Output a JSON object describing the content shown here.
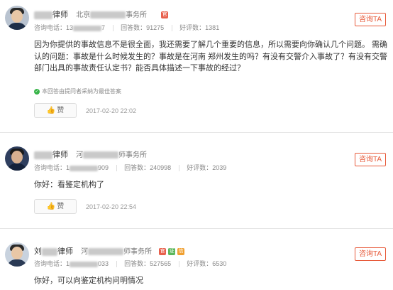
{
  "answers": [
    {
      "name_suffix": "律师",
      "firm_prefix": "北京",
      "firm_suffix": "事务所",
      "badges": [
        {
          "text": "官",
          "color": "#e8604c"
        }
      ],
      "phone_label": "咨询电话：",
      "phone_prefix": "13",
      "phone_suffix": "7",
      "answers_label": "回答数：",
      "answers_count": "91275",
      "rating_label": "好评数：",
      "rating_count": "1381",
      "consult_label": "咨询TA",
      "content": "因为你提供的事故信息不是很全面，我还需要了解几个重要的信息，所以需要向你确认几个问题。 需确认的问题：事故是什么时候发生的？事故是在河南 郑州发生的吗？有没有交警介入事故了？有没有交警部门出具的事故责任认定书？能否具体描述一下事故的经过？",
      "adopted_text": "本回答由提问者采纳为最佳答案",
      "like_label": "赞",
      "date": "2017-02-20 22:02"
    },
    {
      "name_suffix": "律师",
      "firm_prefix": "河",
      "firm_suffix": "师事务所",
      "badges": [],
      "phone_label": "咨询电话：",
      "phone_prefix": "1",
      "phone_suffix": "909",
      "answers_label": "回答数：",
      "answers_count": "240998",
      "rating_label": "好评数：",
      "rating_count": "2039",
      "consult_label": "咨询TA",
      "content": "你好：看鉴定机构了",
      "like_label": "赞",
      "date": "2017-02-20 22:54"
    },
    {
      "name_prefix": "刘",
      "name_suffix": "律师",
      "firm_prefix": "河",
      "firm_suffix": "师事务所",
      "badges": [
        {
          "text": "官",
          "color": "#e8604c"
        },
        {
          "text": "证",
          "color": "#5bb75b"
        },
        {
          "text": "信",
          "color": "#f0a030"
        }
      ],
      "phone_label": "咨询电话：",
      "phone_prefix": "1",
      "phone_suffix": "033",
      "answers_label": "回答数：",
      "answers_count": "527565",
      "rating_label": "好评数：",
      "rating_count": "6530",
      "consult_label": "咨询TA",
      "content": "你好，可以向鉴定机构问明情况"
    }
  ]
}
